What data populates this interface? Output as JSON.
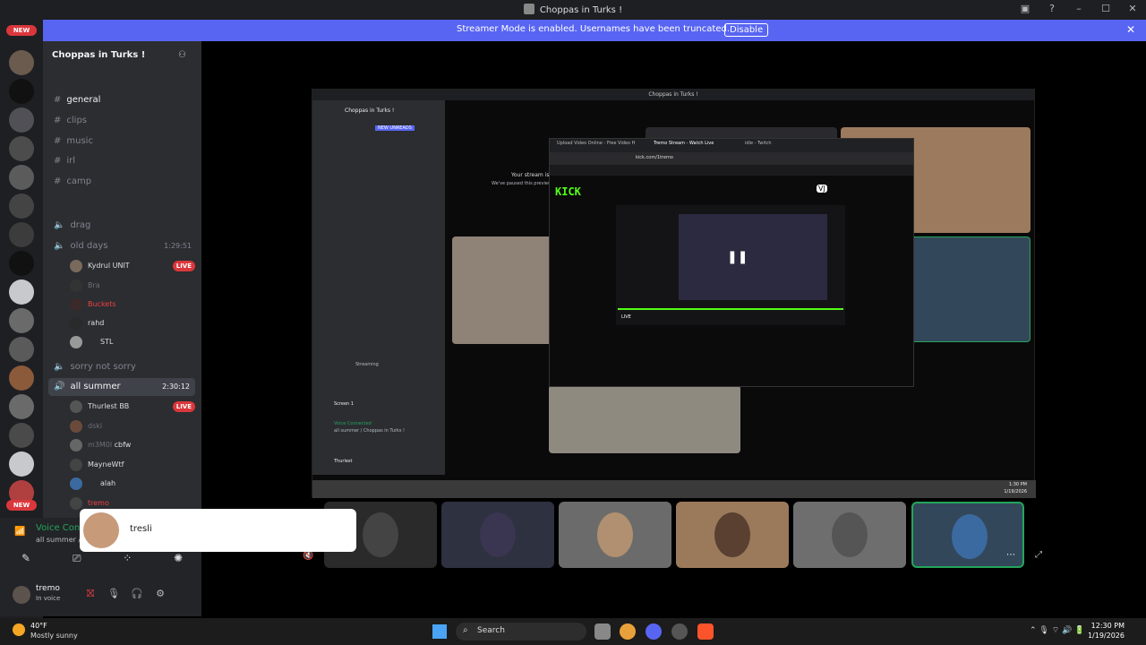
{
  "window": {
    "title": "Choppas in Turks !"
  },
  "banner": {
    "message": "Streamer Mode is enabled. Usernames have been truncated.",
    "disable_label": "Disable"
  },
  "servers": {
    "new_label_top": "NEW",
    "new_label_bottom": "NEW"
  },
  "sidebar": {
    "server_name": "Choppas in Turks !",
    "channels": [
      {
        "name": "general",
        "active": true
      },
      {
        "name": "clips"
      },
      {
        "name": "music"
      },
      {
        "name": "irl"
      },
      {
        "name": "camp"
      }
    ],
    "voice_channels": [
      {
        "name": "drag"
      },
      {
        "name": "old days",
        "time": "1:29:51"
      },
      {
        "name": "sorry not sorry"
      },
      {
        "name": "all summer",
        "time": "2:30:12"
      }
    ],
    "old_days_users": [
      {
        "name": "Kydrul",
        "tag": "UNIT",
        "live": "LIVE"
      },
      {
        "name": "Bra"
      },
      {
        "name": "Buckets"
      },
      {
        "name": "rahd"
      },
      {
        "name": "STL"
      }
    ],
    "all_summer_users": [
      {
        "name": "Thurlest",
        "tag": "BB",
        "live": "LIVE"
      },
      {
        "name": "dski"
      },
      {
        "name": "m3M0l",
        "tag": "cbfw"
      },
      {
        "name": "MayneWtf"
      },
      {
        "name": "alah"
      },
      {
        "name": "tremo"
      }
    ]
  },
  "voice": {
    "status": "Voice Conn",
    "location": "all summer / C"
  },
  "user": {
    "name": "tremo",
    "status": "In voice"
  },
  "popup": {
    "name": "tresli"
  },
  "kick": {
    "tab1": "Upload Video Online - Free Video H",
    "tab2": "Tremo Stream - Watch Live",
    "tab3": "idle - Twitch",
    "url": "kick.com/1tremo",
    "logo": "KICK",
    "live": "LIVE",
    "badge": "VJ"
  },
  "inner": {
    "title": "Choppas in Turks !",
    "server": "Choppas in Turks !",
    "notice1": "Your stream is",
    "notice2": "We've paused this preview",
    "unreads": "NEW UNREADS",
    "screen": "Screen 1",
    "voice_connected": "Voice Connected",
    "voice_location": "all summer / Choppas in Turks !",
    "streaming": "Streaming",
    "user": "Thurlest",
    "time": "1:30 PM",
    "date": "1/19/2026"
  },
  "taskbar": {
    "temp": "40°F",
    "weather": "Mostly sunny",
    "search": "Search",
    "time": "12:30 PM",
    "date": "1/19/2026"
  },
  "colors": {
    "accent": "#5865f2",
    "live": "#da373c",
    "kick": "#53fc18",
    "online": "#23a55a"
  }
}
